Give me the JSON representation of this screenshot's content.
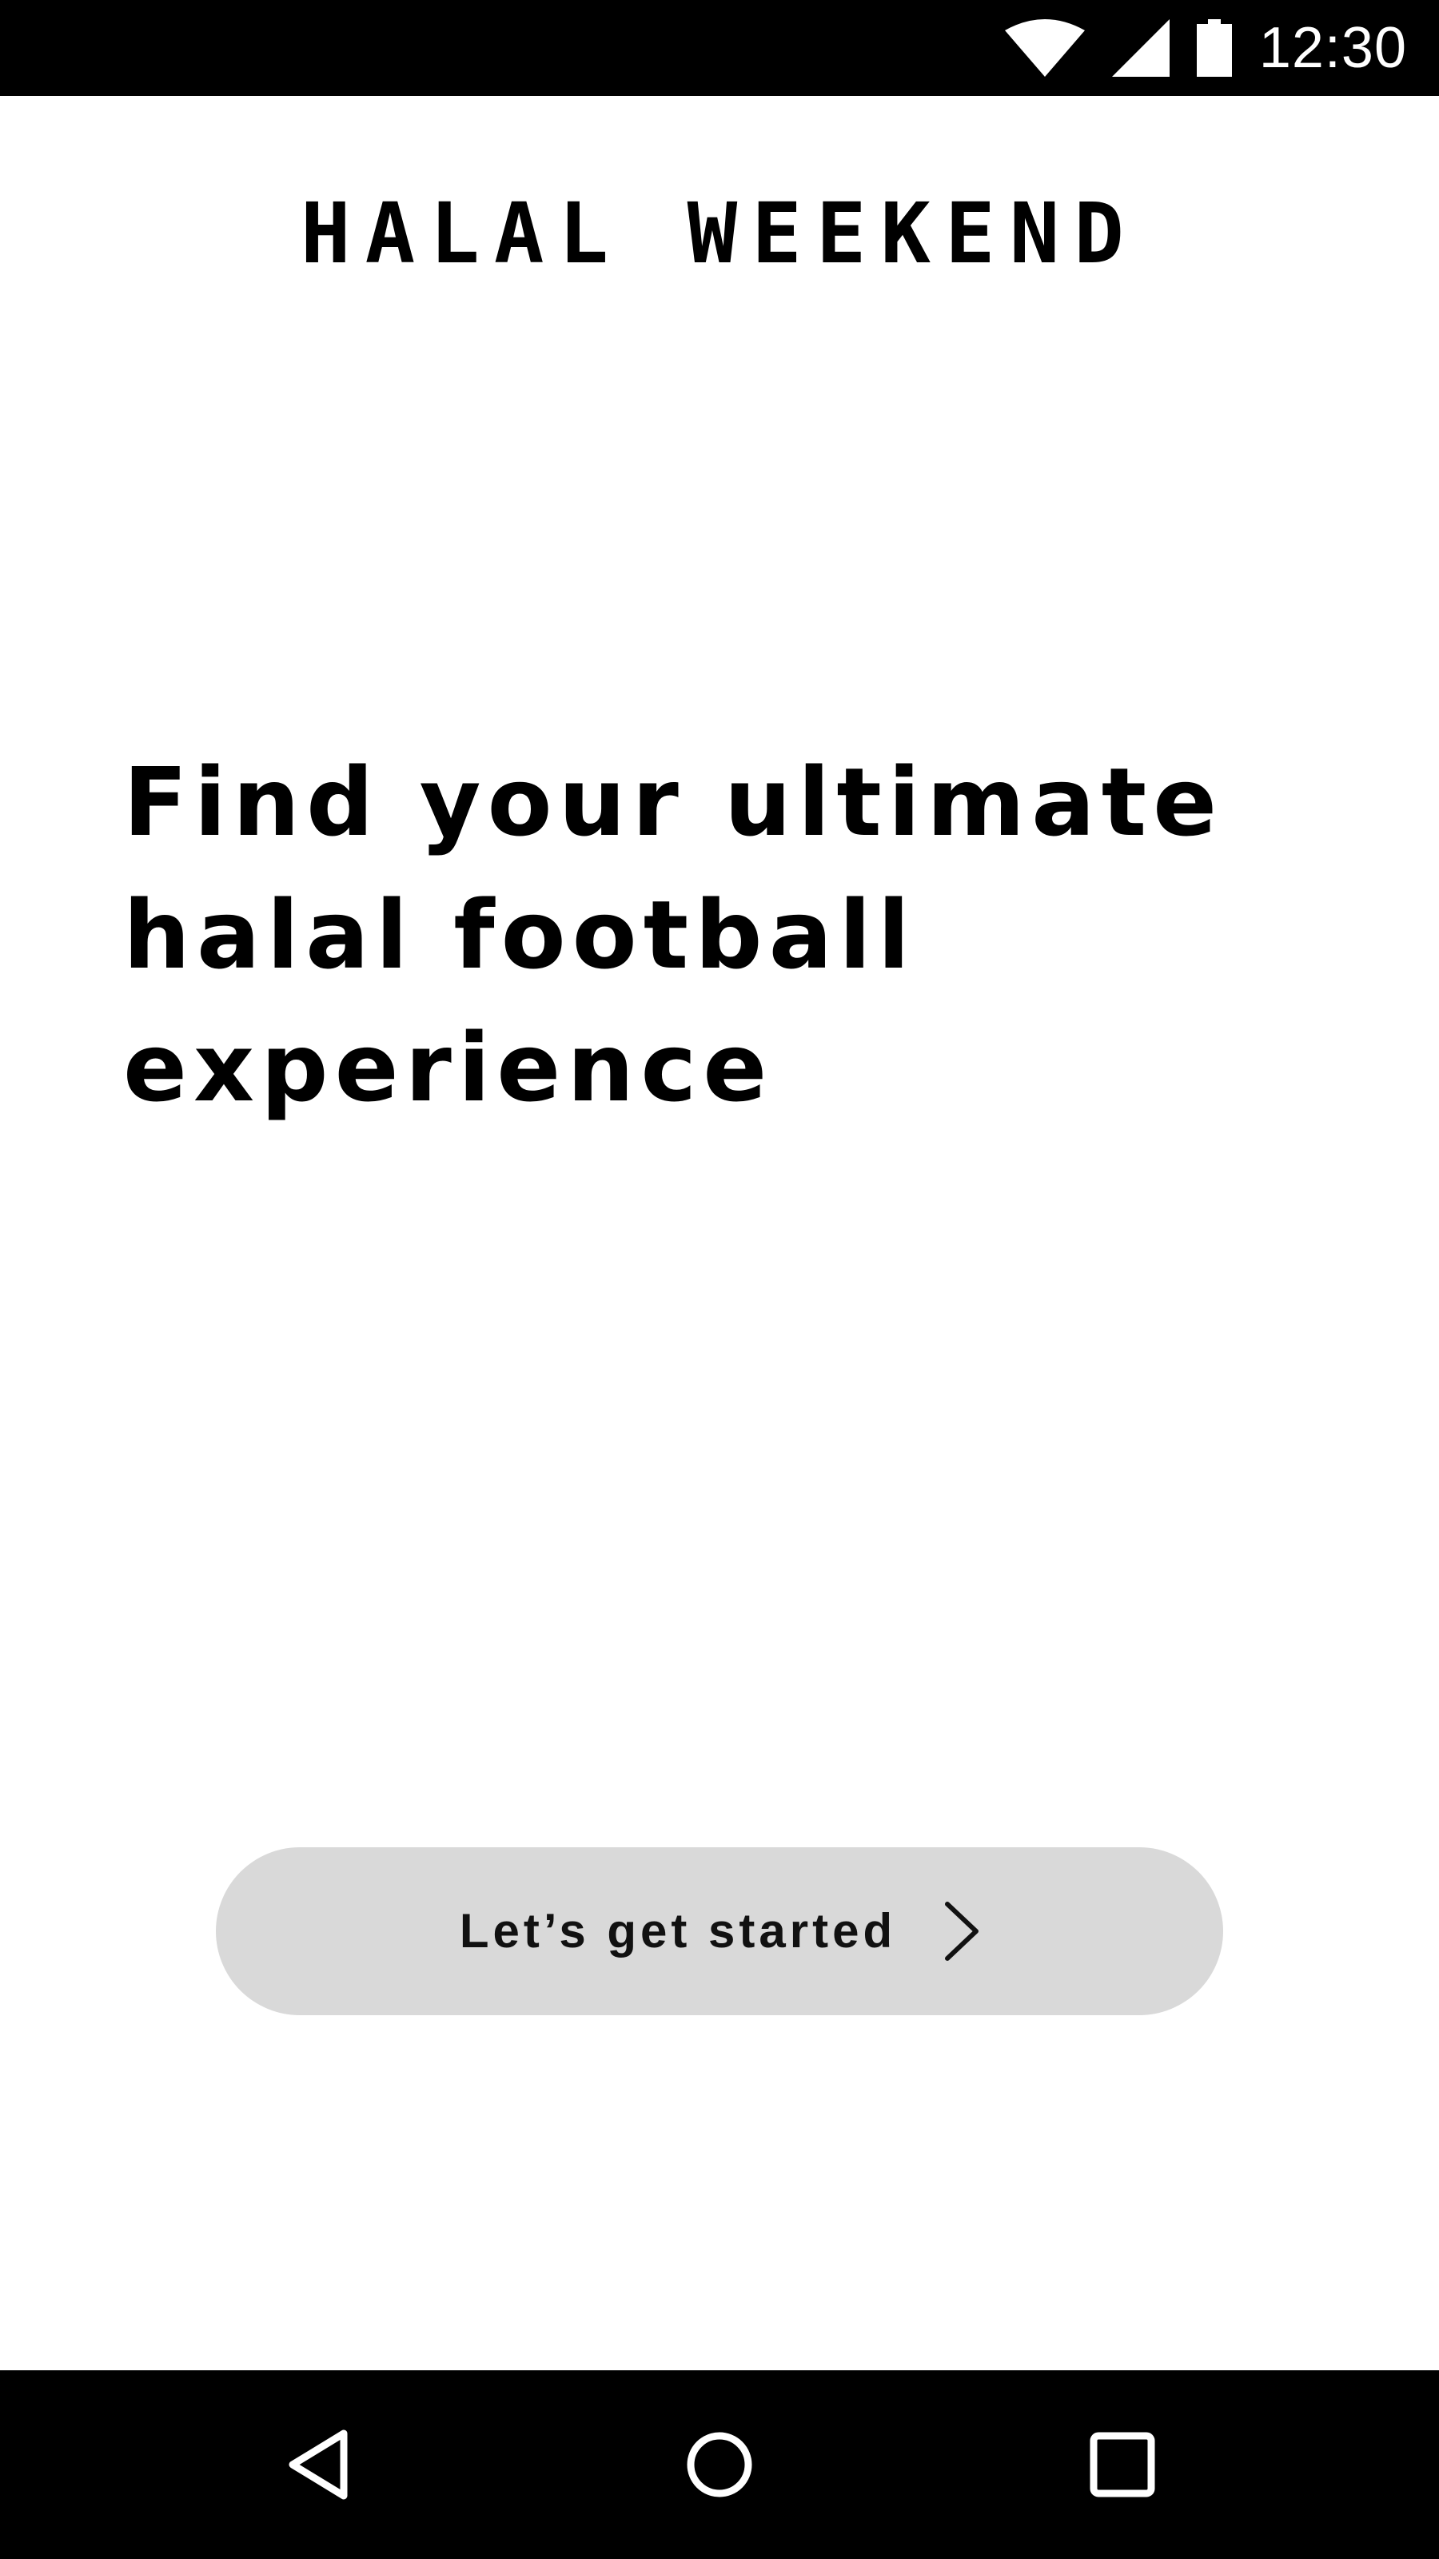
{
  "status_bar": {
    "time": "12:30",
    "icons": [
      "wifi-icon",
      "cellular-signal-icon",
      "battery-icon"
    ]
  },
  "brand": {
    "name": "HALAL WEEKEND"
  },
  "hero": {
    "headline": "Find your ultimate halal football experience"
  },
  "cta": {
    "label": "Let’s get started",
    "icon": "chevron-right-icon"
  },
  "nav_bar": {
    "buttons": [
      "back-icon",
      "home-icon",
      "recents-icon"
    ]
  },
  "colors": {
    "background": "#ffffff",
    "bars": "#000000",
    "button_fill": "#d9d9d9",
    "text": "#000000"
  }
}
